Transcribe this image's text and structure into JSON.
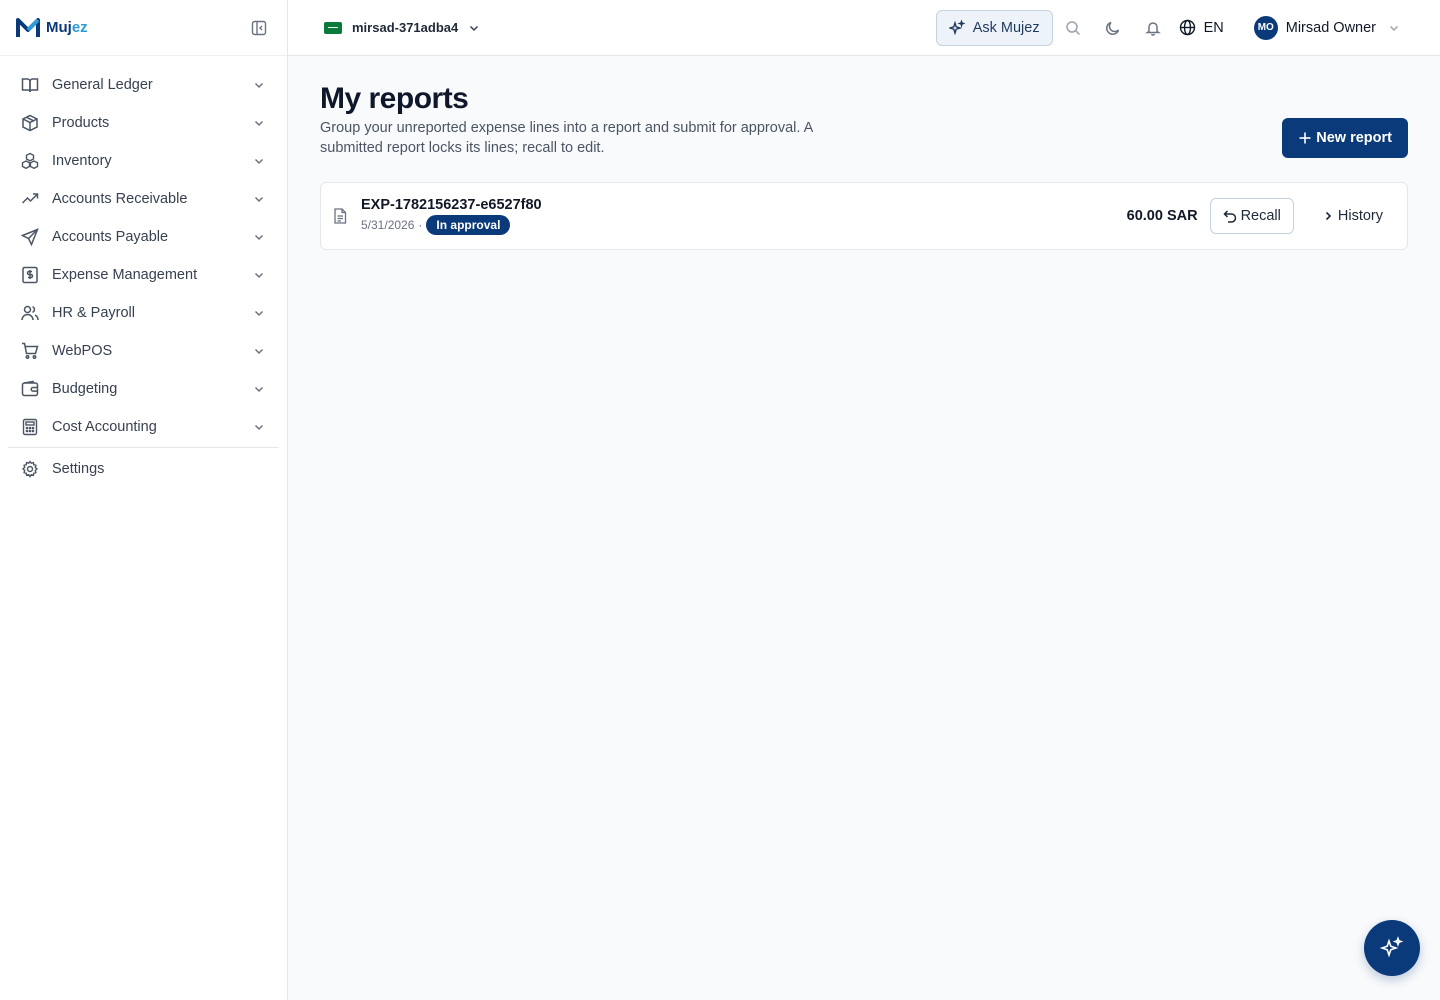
{
  "brand": {
    "name_part1": "Muj",
    "name_part2": "ez",
    "accent": "#0b3a7a"
  },
  "sidebar": {
    "items": [
      {
        "label": "General Ledger",
        "icon": "book-icon"
      },
      {
        "label": "Products",
        "icon": "package-icon"
      },
      {
        "label": "Inventory",
        "icon": "boxes-icon"
      },
      {
        "label": "Accounts Receivable",
        "icon": "trending-up-icon"
      },
      {
        "label": "Accounts Payable",
        "icon": "send-icon"
      },
      {
        "label": "Expense Management",
        "icon": "receipt-icon"
      },
      {
        "label": "HR & Payroll",
        "icon": "users-icon"
      },
      {
        "label": "WebPOS",
        "icon": "cart-icon"
      },
      {
        "label": "Budgeting",
        "icon": "wallet-icon"
      },
      {
        "label": "Cost Accounting",
        "icon": "calculator-icon"
      }
    ],
    "settings_label": "Settings"
  },
  "topbar": {
    "org_name": "mirsad-371adba4",
    "ask_label": "Ask Mujez",
    "language": "EN",
    "user_initials": "MO",
    "user_name": "Mirsad Owner"
  },
  "main": {
    "title": "My reports",
    "description": "Group your unreported expense lines into a report and submit for approval. A submitted report locks its lines; recall to edit.",
    "new_report_label": "New report",
    "reports": [
      {
        "id": "EXP-1782156237-e6527f80",
        "date": "5/31/2026",
        "separator": "·",
        "status": "In approval",
        "amount": "60.00 SAR",
        "recall_label": "Recall",
        "history_label": "History"
      }
    ]
  }
}
